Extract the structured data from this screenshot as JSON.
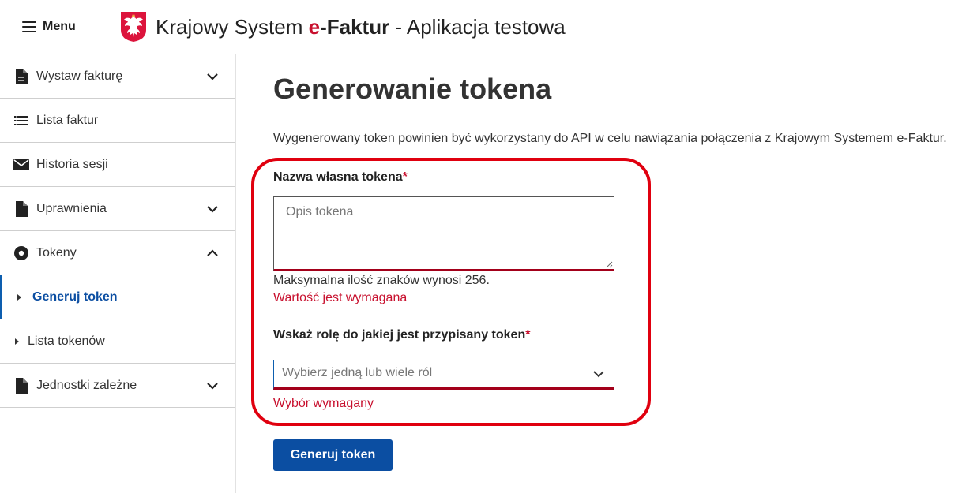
{
  "header": {
    "menu_label": "Menu",
    "title_part1": "Krajowy System ",
    "title_e": "e",
    "title_faktur": "-Faktur",
    "title_suffix": " - Aplikacja testowa"
  },
  "sidebar": {
    "items": [
      {
        "label": "Wystaw fakturę",
        "icon": "document-icon",
        "chevron": "down"
      },
      {
        "label": "Lista faktur",
        "icon": "list-icon"
      },
      {
        "label": "Historia sesji",
        "icon": "envelope-icon"
      },
      {
        "label": "Uprawnienia",
        "icon": "document-icon",
        "chevron": "down"
      },
      {
        "label": "Tokeny",
        "icon": "disc-icon",
        "chevron": "up"
      },
      {
        "label": "Generuj token",
        "sub": true,
        "active": true
      },
      {
        "label": "Lista tokenów",
        "sub": true
      },
      {
        "label": "Jednostki zależne",
        "icon": "document-icon",
        "chevron": "down"
      }
    ]
  },
  "main": {
    "title": "Generowanie tokena",
    "description": "Wygenerowany token powinien być wykorzystany do API w celu nawiązania połączenia z Krajowym Systemem e-Faktur.",
    "name_field": {
      "label": "Nazwa własna tokena",
      "required_mark": "*",
      "placeholder": "Opis tokena",
      "value": "",
      "hint": "Maksymalna ilość znaków wynosi 256.",
      "error": "Wartość jest wymagana"
    },
    "role_field": {
      "label": "Wskaż rolę do jakiej jest przypisany token",
      "required_mark": "*",
      "placeholder": "Wybierz jedną lub wiele ról",
      "error": "Wybór wymagany"
    },
    "submit_label": "Generuj token"
  },
  "colors": {
    "primary": "#0b4ea2",
    "error": "#c8102e",
    "highlight": "#e0000f"
  }
}
